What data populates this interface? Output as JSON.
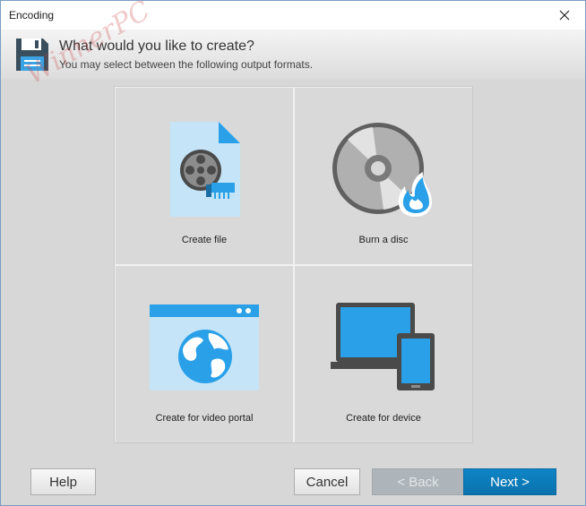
{
  "window": {
    "title": "Encoding"
  },
  "header": {
    "title": "What would you like to create?",
    "subtitle": "You may select between the following output formats.",
    "icon": "floppy-disk-icon"
  },
  "watermark": "WinnerPC",
  "options": [
    {
      "label": "Create file",
      "icon": "movie-file-icon"
    },
    {
      "label": "Burn a disc",
      "icon": "burn-disc-icon"
    },
    {
      "label": "Create for video portal",
      "icon": "web-globe-icon"
    },
    {
      "label": "Create for device",
      "icon": "laptop-phone-icon"
    }
  ],
  "buttons": {
    "help": "Help",
    "cancel": "Cancel",
    "back": "< Back",
    "next": "Next >"
  },
  "colors": {
    "accent": "#0a7bbf",
    "icon_blue": "#29a0e8",
    "light_blue": "#c5e4f8"
  }
}
